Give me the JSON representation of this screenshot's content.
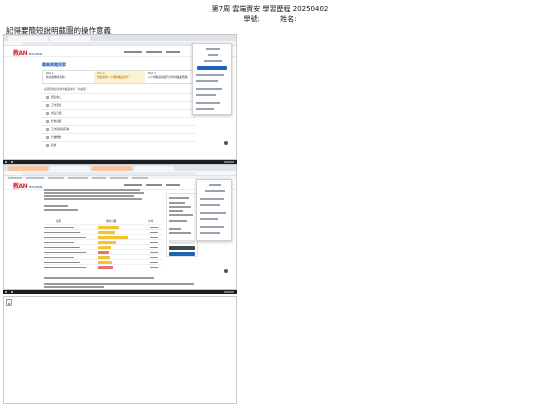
{
  "header": {
    "line1": "第7周 雲端資安 學習歷程 20250402",
    "student_id_label": "學號:",
    "name_label": "姓名:"
  },
  "title": "記得要簡短說明截圖的操作意義",
  "screenshot1": {
    "logo": "教AN",
    "logo_sub": "EDUCATION",
    "section_title": "職業興趣探索",
    "steps": [
      {
        "label": "Part 1",
        "text": "你喜歡哪種活動？"
      },
      {
        "label": "Part 2",
        "text": "你最看重以下哪種職業條件？"
      },
      {
        "label": "Part 3",
        "text": "以下哪個選項最符合你的職業興趣？"
      }
    ],
    "active_step": 2,
    "list_caption": "請選擇你最重視的職業條件（可複選）",
    "options": [
      "穩定收入",
      "工作彈性",
      "成長空間",
      "社會貢獻",
      "工作環境與同事",
      "升遷機會",
      "其他"
    ]
  },
  "screenshot2": {
    "table_headers": [
      "項目",
      "你的分數",
      "平均"
    ],
    "bar_colors": [
      "#f4c430",
      "#f4c430",
      "#f4c430",
      "#f4c430",
      "#f4c430",
      "#e57373",
      "#f4c430",
      "#f4c430",
      "#e57373"
    ],
    "bar_fraction": [
      0.44,
      0.36,
      0.62,
      0.38,
      0.28,
      0.22,
      0.26,
      0.3,
      0.32
    ]
  },
  "colors": {
    "accent_blue": "#1e63b5",
    "highlight": "#fdf2d0",
    "logo_red": "#d32f2f"
  }
}
